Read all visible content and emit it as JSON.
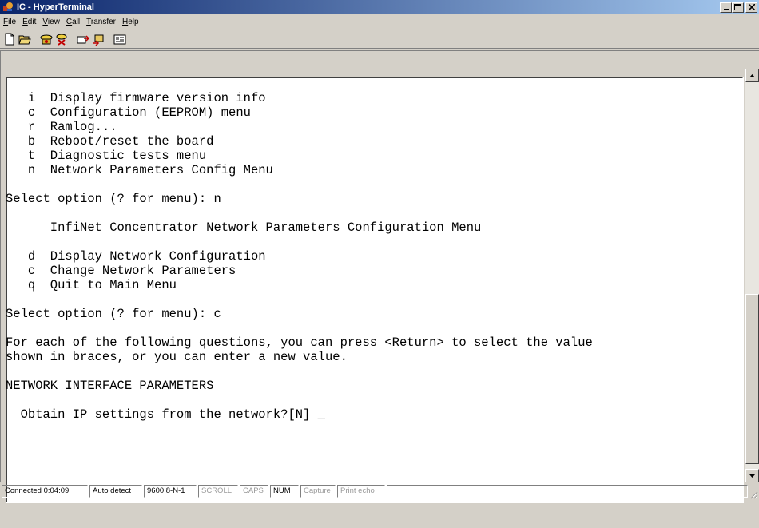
{
  "window": {
    "title": "IC - HyperTerminal"
  },
  "menubar": {
    "items": [
      {
        "label": "File",
        "accel": "F",
        "rest": "ile"
      },
      {
        "label": "Edit",
        "accel": "E",
        "rest": "dit"
      },
      {
        "label": "View",
        "accel": "V",
        "rest": "iew"
      },
      {
        "label": "Call",
        "accel": "C",
        "rest": "all"
      },
      {
        "label": "Transfer",
        "accel": "T",
        "rest": "ransfer"
      },
      {
        "label": "Help",
        "accel": "H",
        "rest": "elp"
      }
    ]
  },
  "toolbar": {
    "buttons": [
      "new-icon",
      "open-icon",
      "call-icon",
      "disconnect-icon",
      "send-icon",
      "receive-icon",
      "properties-icon"
    ]
  },
  "terminal": {
    "lines": [
      "",
      "   i  Display firmware version info",
      "   c  Configuration (EEPROM) menu",
      "   r  Ramlog...",
      "   b  Reboot/reset the board",
      "   t  Diagnostic tests menu",
      "   n  Network Parameters Config Menu",
      "",
      "Select option (? for menu): n",
      "",
      "      InfiNet Concentrator Network Parameters Configuration Menu",
      "",
      "   d  Display Network Configuration",
      "   c  Change Network Parameters",
      "   q  Quit to Main Menu",
      "",
      "Select option (? for menu): c",
      "",
      "For each of the following questions, you can press <Return> to select the value",
      "shown in braces, or you can enter a new value.",
      "",
      "NETWORK INTERFACE PARAMETERS",
      "",
      "  Obtain IP settings from the network?[N] _"
    ]
  },
  "statusbar": {
    "connected": "Connected 0:04:09",
    "detect": "Auto detect",
    "settings": "9600 8-N-1",
    "scroll": "SCROLL",
    "caps": "CAPS",
    "num": "NUM",
    "capture": "Capture",
    "print_echo": "Print echo"
  },
  "colors": {
    "title_gradient_start": "#0a246a",
    "title_gradient_end": "#a6caf0",
    "chrome": "#d4d0c8",
    "terminal_bg": "#ffffff"
  }
}
